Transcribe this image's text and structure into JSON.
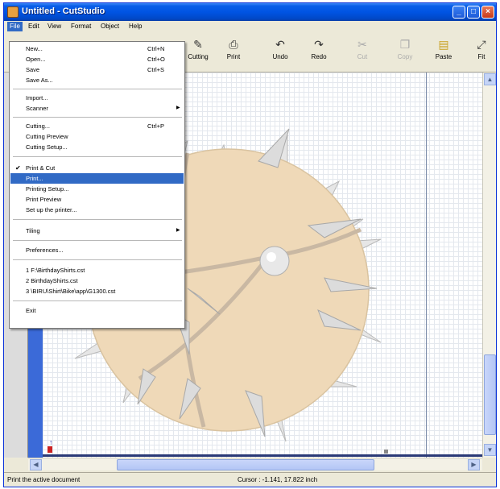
{
  "window": {
    "title": "Untitled - CutStudio",
    "controls": [
      "_",
      "□",
      "×"
    ]
  },
  "menubar": [
    "File",
    "Edit",
    "View",
    "Format",
    "Object",
    "Help"
  ],
  "toolbar": {
    "buttons": [
      {
        "label": "Cutting",
        "icon": "cutting-icon",
        "enabled": true
      },
      {
        "label": "Print",
        "icon": "print-icon",
        "enabled": true
      },
      {
        "label": "Undo",
        "icon": "undo-icon",
        "enabled": true
      },
      {
        "label": "Redo",
        "icon": "redo-icon",
        "enabled": true
      },
      {
        "label": "Cut",
        "icon": "cut-icon",
        "enabled": false
      },
      {
        "label": "Copy",
        "icon": "copy-icon",
        "enabled": false
      },
      {
        "label": "Paste",
        "icon": "paste-icon",
        "enabled": true
      },
      {
        "label": "Fit",
        "icon": "fit-icon",
        "enabled": true
      }
    ]
  },
  "file_menu": {
    "groups": [
      [
        {
          "label": "New...",
          "shortcut": "Ctrl+N"
        },
        {
          "label": "Open...",
          "shortcut": "Ctrl+O"
        },
        {
          "label": "Save",
          "shortcut": "Ctrl+S"
        },
        {
          "label": "Save As..."
        }
      ],
      [
        {
          "label": "Import..."
        },
        {
          "label": "Scanner",
          "submenu": true
        }
      ],
      [
        {
          "label": "Cutting...",
          "shortcut": "Ctrl+P"
        },
        {
          "label": "Cutting Preview"
        },
        {
          "label": "Cutting Setup..."
        }
      ],
      [
        {
          "label": "Print & Cut",
          "checked": true
        },
        {
          "label": "Print...",
          "highlighted": true
        },
        {
          "label": "Printing Setup..."
        },
        {
          "label": "Print Preview"
        },
        {
          "label": "Set up the printer..."
        }
      ],
      [
        {
          "label": "Tiling",
          "submenu": true
        }
      ],
      [
        {
          "label": "Preferences..."
        }
      ],
      [
        {
          "label": "1 F:\\BirthdayShirts.cst"
        },
        {
          "label": "2 BirthdayShirts.cst"
        },
        {
          "label": "3 \\BIRU\\Shirt\\Bike\\app\\G1300.cst"
        }
      ],
      [
        {
          "label": "Exit"
        }
      ]
    ]
  },
  "statusbar": {
    "message": "Print the active document",
    "cursor": "Cursor : -1.141, 17.822 inch"
  },
  "colors": {
    "titlebar": "#0054e3",
    "menu_highlight": "#316ac5",
    "artwork_fill": "#efd9b8",
    "spike": "#dcdcdc"
  }
}
